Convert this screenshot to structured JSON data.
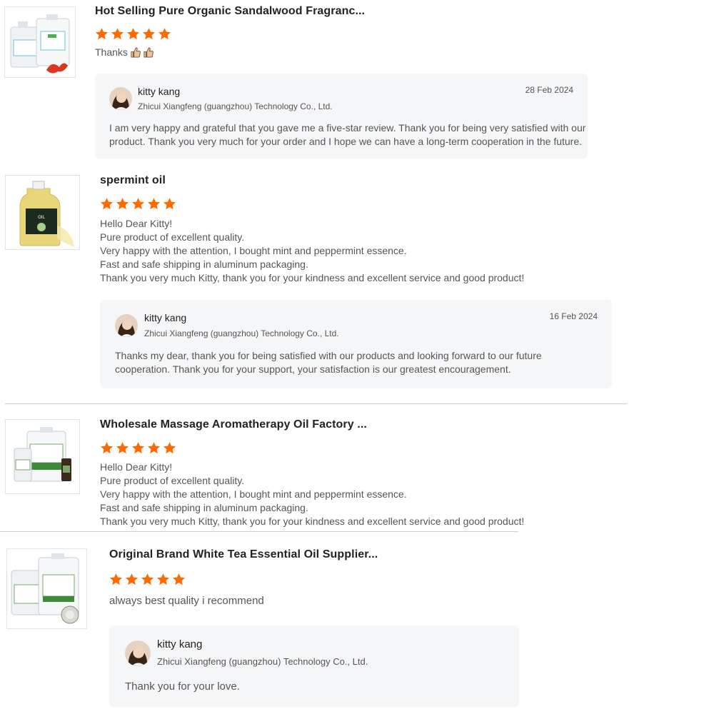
{
  "colors": {
    "star": "#ff6a00",
    "reply_bg": "#f5f6f8",
    "divider": "#cfcfcf"
  },
  "reviews": [
    {
      "title": "Hot Selling Pure Organic Sandalwood Fragranc...",
      "rating": 5,
      "comment": "Thanks",
      "comment_emoji": "thumbs-up-icon",
      "reply": {
        "name": "kitty kang",
        "company": "Zhicui Xiangfeng (guangzhou) Technology Co., Ltd.",
        "date": "28 Feb 2024",
        "lines": [
          "I am very happy and grateful that you gave me a five-star review. Thank you for being very satisfied with our",
          "product. Thank you very much for your order and I hope we can have a long-term cooperation in the future."
        ]
      }
    },
    {
      "title": "spermint oil",
      "rating": 5,
      "comment_lines": [
        "Hello Dear Kitty!",
        "Pure product of excellent quality.",
        "Very happy with the attention, I bought mint and peppermint essence.",
        "Fast and safe shipping in aluminum packaging.",
        "Thank you very much Kitty, thank you for your kindness and excellent service and good product!"
      ],
      "reply": {
        "name": "kitty kang",
        "company": "Zhicui Xiangfeng (guangzhou) Technology Co., Ltd.",
        "date": "16 Feb 2024",
        "lines": [
          "Thanks my dear, thank you for being satisfied with our products and looking forward to our future",
          "cooperation. Thank you for your support, your satisfaction is our greatest encouragement."
        ]
      }
    },
    {
      "title": "Wholesale Massage Aromatherapy Oil Factory ...",
      "rating": 5,
      "comment_lines": [
        "Hello Dear Kitty!",
        "Pure product of excellent quality.",
        "Very happy with the attention, I bought mint and peppermint essence.",
        "Fast and safe shipping in aluminum packaging.",
        "Thank you very much Kitty, thank you for your kindness and excellent service and good product!"
      ]
    },
    {
      "title": "Original Brand White Tea Essential Oil Supplier...",
      "rating": 5,
      "comment": "always best quality i recommend",
      "reply": {
        "name": "kitty kang",
        "company": "Zhicui Xiangfeng (guangzhou) Technology Co., Ltd.",
        "lines": [
          "Thank you for your love."
        ]
      }
    }
  ]
}
